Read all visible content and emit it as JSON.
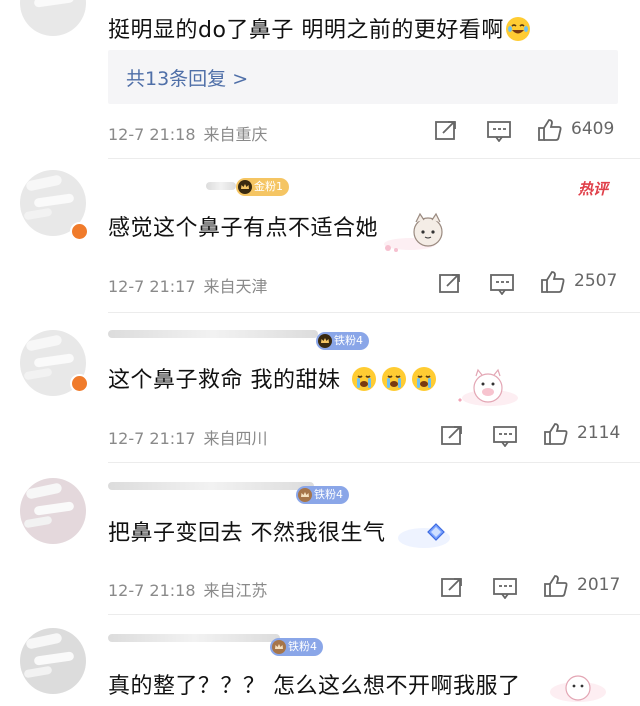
{
  "comments": [
    {
      "text": "挺明显的do了鼻子 明明之前的更好看啊",
      "emoji": "laughing-tears-emoji",
      "replies_link": "共13条回复 >",
      "time": "12-7 21:18",
      "location": "来自重庆",
      "likes": "6409"
    },
    {
      "fan_badge": "金粉1",
      "hot_tag": "热评",
      "text": "感觉这个鼻子有点不适合她",
      "sticker": "cat-sticker",
      "time": "12-7 21:17",
      "location": "来自天津",
      "likes": "2507"
    },
    {
      "fan_badge": "铁粉4",
      "text": "这个鼻子救命 我的甜妹",
      "emoji": "crying-emoji",
      "sticker": "pink-pig-sticker",
      "time": "12-7 21:17",
      "location": "来自四川",
      "likes": "2114"
    },
    {
      "fan_badge": "铁粉4",
      "text": "把鼻子变回去 不然我很生气",
      "sticker": "blue-diamond-sticker",
      "time": "12-7 21:18",
      "location": "来自江苏",
      "likes": "2017"
    },
    {
      "fan_badge": "铁粉4",
      "text": "真的整了？？？ 怎么这么想不开啊我服了",
      "sticker": "cartoon-sticker"
    }
  ],
  "colors": {
    "link": "#4f6fa8",
    "hot": "#e0404a",
    "meta": "#8a8a8a"
  }
}
